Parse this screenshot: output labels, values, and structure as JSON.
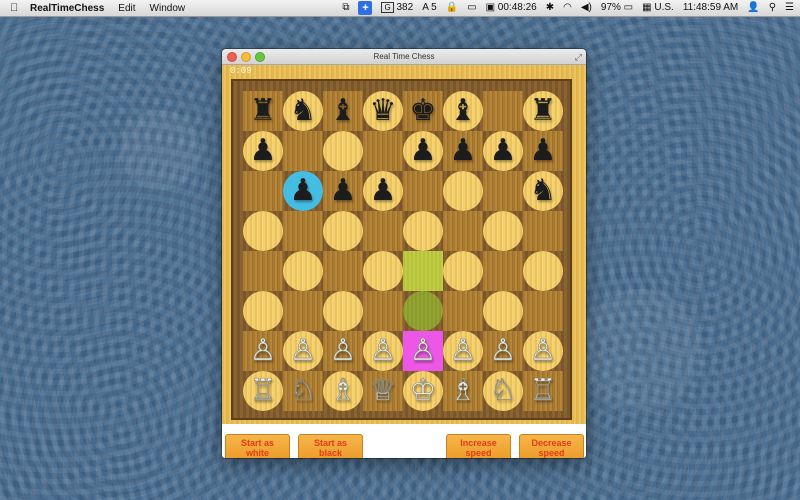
{
  "menubar": {
    "app_name": "RealTimeChess",
    "menus": [
      "Edit",
      "Window"
    ],
    "status": {
      "badge_count": "382",
      "text_badge": "5",
      "battery_time": "00:48:26",
      "battery_percent": "97%",
      "locale": "U.S.",
      "clock": "11:48:59 AM"
    }
  },
  "window": {
    "title": "Real Time Chess",
    "timer": "0:09"
  },
  "board": {
    "squares": [
      [
        {
          "p": "♜",
          "c": "black"
        },
        {
          "p": "♞",
          "c": "black"
        },
        {
          "p": "♝",
          "c": "black"
        },
        {
          "p": "♛",
          "c": "black"
        },
        {
          "p": "♚",
          "c": "black"
        },
        {
          "p": "♝",
          "c": "black"
        },
        {
          "p": "",
          "c": ""
        },
        {
          "p": "♜",
          "c": "black"
        }
      ],
      [
        {
          "p": "♟",
          "c": "black"
        },
        {
          "p": "",
          "c": ""
        },
        {
          "p": "",
          "c": ""
        },
        {
          "p": "",
          "c": ""
        },
        {
          "p": "♟",
          "c": "black"
        },
        {
          "p": "♟",
          "c": "black"
        },
        {
          "p": "♟",
          "c": "black"
        },
        {
          "p": "♟",
          "c": "black"
        }
      ],
      [
        {
          "p": "",
          "c": ""
        },
        {
          "p": "♟",
          "c": "black",
          "hl": "cyan"
        },
        {
          "p": "♟",
          "c": "black"
        },
        {
          "p": "♟",
          "c": "black"
        },
        {
          "p": "",
          "c": ""
        },
        {
          "p": "",
          "c": ""
        },
        {
          "p": "",
          "c": ""
        },
        {
          "p": "♞",
          "c": "black"
        }
      ],
      [
        {
          "p": "",
          "c": ""
        },
        {
          "p": "",
          "c": ""
        },
        {
          "p": "",
          "c": ""
        },
        {
          "p": "",
          "c": ""
        },
        {
          "p": "",
          "c": ""
        },
        {
          "p": "",
          "c": ""
        },
        {
          "p": "",
          "c": ""
        },
        {
          "p": "",
          "c": ""
        }
      ],
      [
        {
          "p": "",
          "c": ""
        },
        {
          "p": "",
          "c": ""
        },
        {
          "p": "",
          "c": ""
        },
        {
          "p": "",
          "c": ""
        },
        {
          "p": "",
          "c": "",
          "hl": "lime1"
        },
        {
          "p": "",
          "c": ""
        },
        {
          "p": "",
          "c": ""
        },
        {
          "p": "",
          "c": ""
        }
      ],
      [
        {
          "p": "",
          "c": ""
        },
        {
          "p": "",
          "c": ""
        },
        {
          "p": "",
          "c": ""
        },
        {
          "p": "",
          "c": ""
        },
        {
          "p": "",
          "c": "",
          "hl": "lime2"
        },
        {
          "p": "",
          "c": ""
        },
        {
          "p": "",
          "c": ""
        },
        {
          "p": "",
          "c": ""
        }
      ],
      [
        {
          "p": "♙",
          "c": "white"
        },
        {
          "p": "♙",
          "c": "white"
        },
        {
          "p": "♙",
          "c": "white"
        },
        {
          "p": "♙",
          "c": "white"
        },
        {
          "p": "♙",
          "c": "white",
          "hl": "pink"
        },
        {
          "p": "♙",
          "c": "white"
        },
        {
          "p": "♙",
          "c": "white"
        },
        {
          "p": "♙",
          "c": "white"
        }
      ],
      [
        {
          "p": "♖",
          "c": "white"
        },
        {
          "p": "♘",
          "c": "white"
        },
        {
          "p": "♗",
          "c": "white"
        },
        {
          "p": "♕",
          "c": "white"
        },
        {
          "p": "♔",
          "c": "white"
        },
        {
          "p": "♗",
          "c": "white"
        },
        {
          "p": "♘",
          "c": "white"
        },
        {
          "p": "♖",
          "c": "white"
        }
      ]
    ]
  },
  "buttons": {
    "start_white": "Start as white",
    "start_black": "Start as black",
    "increase_speed": "Increase speed",
    "decrease_speed": "Decrease speed"
  },
  "colors": {
    "highlight_selected": "#45bde3",
    "highlight_move": "#ec57e7",
    "highlight_path": "#b5c23a",
    "button_text": "#e43b1c"
  }
}
